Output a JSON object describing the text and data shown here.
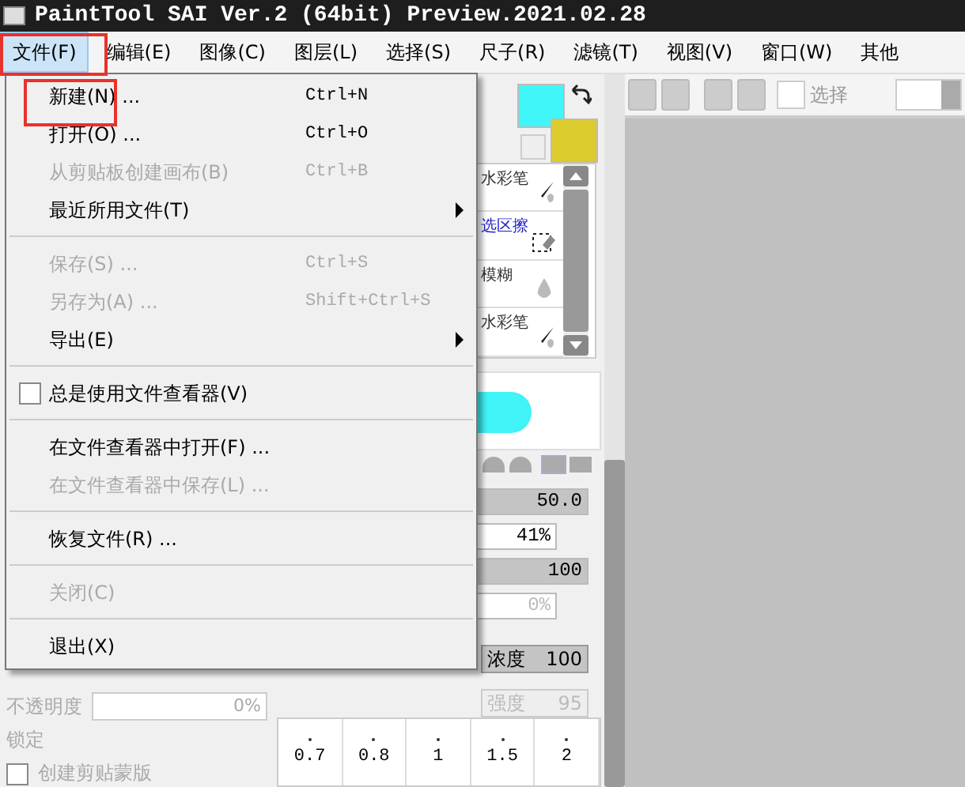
{
  "window": {
    "title": "PaintTool SAI Ver.2 (64bit) Preview.2021.02.28"
  },
  "menubar": [
    {
      "label": "文件(F)",
      "selected": true
    },
    {
      "label": "编辑(E)",
      "selected": false
    },
    {
      "label": "图像(C)",
      "selected": false
    },
    {
      "label": "图层(L)",
      "selected": false
    },
    {
      "label": "选择(S)",
      "selected": false
    },
    {
      "label": "尺子(R)",
      "selected": false
    },
    {
      "label": "滤镜(T)",
      "selected": false
    },
    {
      "label": "视图(V)",
      "selected": false
    },
    {
      "label": "窗口(W)",
      "selected": false
    },
    {
      "label": "其他",
      "selected": false
    }
  ],
  "file_menu": [
    {
      "kind": "item",
      "label": "新建(N) ...",
      "shortcut": "Ctrl+N",
      "disabled": false,
      "submenu": false
    },
    {
      "kind": "item",
      "label": "打开(O) ...",
      "shortcut": "Ctrl+O",
      "disabled": false,
      "submenu": false
    },
    {
      "kind": "item",
      "label": "从剪贴板创建画布(B)",
      "shortcut": "Ctrl+B",
      "disabled": true,
      "submenu": false
    },
    {
      "kind": "item",
      "label": "最近所用文件(T)",
      "disabled": false,
      "submenu": true
    },
    {
      "kind": "separator"
    },
    {
      "kind": "item",
      "label": "保存(S) ...",
      "shortcut": "Ctrl+S",
      "disabled": true,
      "submenu": false
    },
    {
      "kind": "item",
      "label": "另存为(A) ...",
      "shortcut": "Shift+Ctrl+S",
      "disabled": true,
      "submenu": false
    },
    {
      "kind": "item",
      "label": "导出(E)",
      "disabled": false,
      "submenu": true
    },
    {
      "kind": "separator"
    },
    {
      "kind": "checkbox",
      "label": "总是使用文件查看器(V)",
      "checked": false,
      "disabled": false
    },
    {
      "kind": "separator"
    },
    {
      "kind": "item",
      "label": "在文件查看器中打开(F) ...",
      "disabled": false,
      "submenu": false
    },
    {
      "kind": "item",
      "label": "在文件查看器中保存(L) ...",
      "disabled": true,
      "submenu": false
    },
    {
      "kind": "separator"
    },
    {
      "kind": "item",
      "label": "恢复文件(R) ...",
      "disabled": false,
      "submenu": false
    },
    {
      "kind": "separator"
    },
    {
      "kind": "item",
      "label": "关闭(C)",
      "disabled": true,
      "submenu": false
    },
    {
      "kind": "separator"
    },
    {
      "kind": "item",
      "label": "退出(X)",
      "disabled": false,
      "submenu": false
    }
  ],
  "toolbar": {
    "select_label": "选择",
    "select_checked": false
  },
  "color_swatches": [
    {
      "color": "#40f6f8"
    },
    {
      "color": "#dccb2c"
    }
  ],
  "tools": [
    {
      "kind": "brush",
      "label": "水彩笔",
      "color": "#333333"
    },
    {
      "kind": "selection",
      "label": "选区擦",
      "color": "#1a1acc"
    },
    {
      "kind": "blur",
      "label": "模糊",
      "color": "#333333"
    },
    {
      "kind": "brush",
      "label": "水彩笔",
      "color": "#333333"
    }
  ],
  "brush_settings": [
    {
      "kind": "slider",
      "reading": "50.0",
      "level": 1
    },
    {
      "kind": "field",
      "reading": "41%",
      "disabled": false
    },
    {
      "kind": "slider",
      "reading": "100",
      "level": 1
    },
    {
      "kind": "field",
      "reading": "0%",
      "disabled": true
    }
  ],
  "mix_settings": [
    {
      "label": "浓度",
      "reading": "100",
      "disabled": false
    },
    {
      "label": "强度",
      "reading": "95",
      "disabled": true
    }
  ],
  "brush_sizes": [
    "0.7",
    "0.8",
    "1",
    "1.5",
    "2"
  ],
  "layer_panel": {
    "opacity_label": "不透明度",
    "opacity": "0%",
    "lock_label": "锁定",
    "clip_label": "创建剪贴蒙版",
    "clip_checked": false
  }
}
